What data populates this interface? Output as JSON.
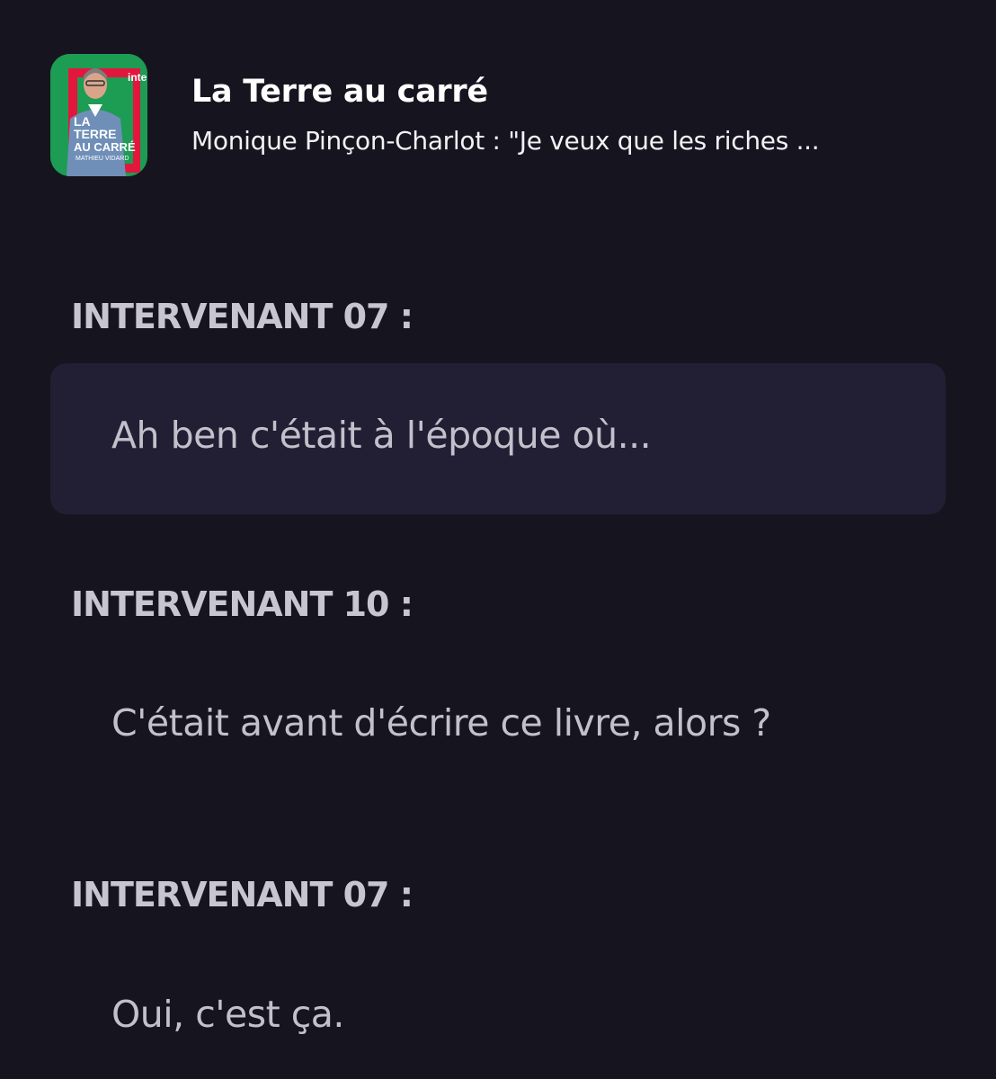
{
  "podcast": {
    "title": "La Terre au carré",
    "episode": "Monique Pinçon-Charlot :  \"Je veux que les riches ...",
    "artwork": {
      "line1": "LA",
      "line2": "TERRE",
      "line3": "AU CARRÉ",
      "host": "MATHIEU VIDARD",
      "brand": "inter"
    }
  },
  "transcript": [
    {
      "speaker": "INTERVENANT 07 :",
      "text": "Ah ben c'était à l'époque où...",
      "active": true
    },
    {
      "speaker": "INTERVENANT 10 :",
      "text": "C'était avant d'écrire ce livre, alors ?",
      "active": false
    },
    {
      "speaker": "INTERVENANT 07 :",
      "text": "Oui, c'est ça.",
      "active": false
    }
  ],
  "colors": {
    "background": "#16151f",
    "active_bubble": "#221f35",
    "artwork_green": "#1d9c54",
    "artwork_red": "#e3163e"
  }
}
